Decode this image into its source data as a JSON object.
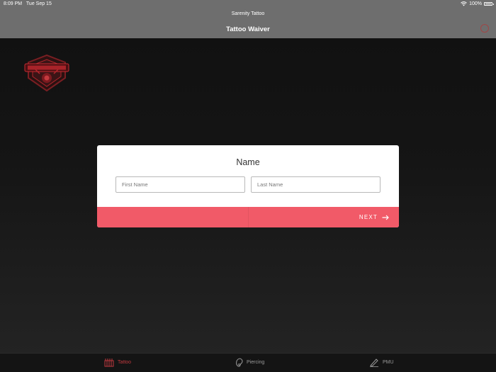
{
  "status_bar": {
    "time": "8:09 PM",
    "date": "Tue Sep 15",
    "battery": "100%"
  },
  "nav_bar": {
    "app_name": "Sarenity Tattoo",
    "title": "Tattoo Waiver"
  },
  "form": {
    "title": "Name",
    "first_name": {
      "value": "",
      "placeholder": "First Name"
    },
    "last_name": {
      "value": "",
      "placeholder": "Last Name"
    },
    "next_label": "NEXT"
  },
  "tabs": [
    {
      "label": "Tattoo",
      "icon": "tattoo-machine-icon",
      "active": true
    },
    {
      "label": "Piercing",
      "icon": "ear-icon",
      "active": false
    },
    {
      "label": "PMU",
      "icon": "pen-icon",
      "active": false
    }
  ],
  "colors": {
    "accent": "#f15a68",
    "active_tab": "#c0393e",
    "nav_bg": "#6e6e6e",
    "background": "#161616"
  }
}
